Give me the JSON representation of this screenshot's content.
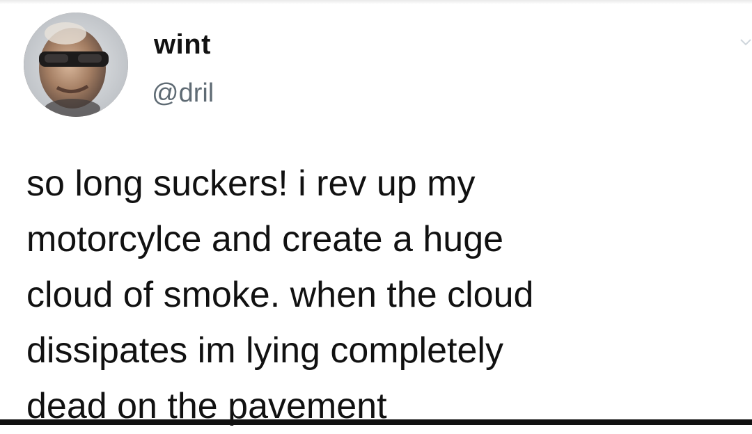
{
  "author": {
    "display_name": "wint",
    "handle": "@dril",
    "avatar_icon": "profile-photo-icon"
  },
  "menu": {
    "icon": "chevron-down-icon",
    "color": "#cfd6dc"
  },
  "tweet": {
    "lines": [
      "so long suckers! i rev up my",
      "motorcylce and create a huge",
      "cloud of smoke. when the cloud",
      "dissipates im lying completely",
      "dead on the pavement"
    ]
  },
  "colors": {
    "text": "#111111",
    "handle": "#5f6b74",
    "background": "#ffffff"
  }
}
